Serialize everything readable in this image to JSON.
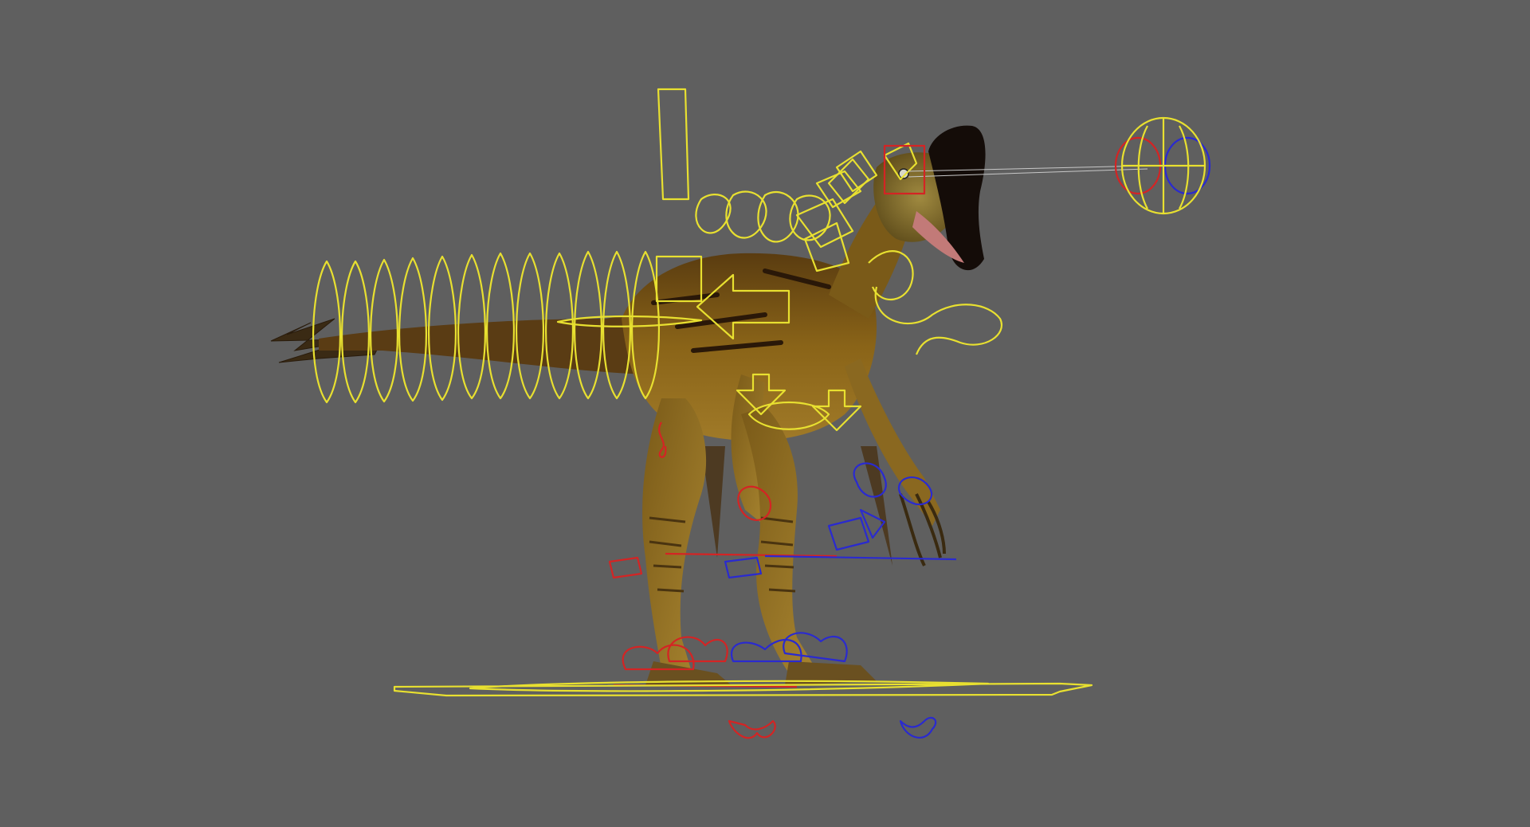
{
  "viewport": {
    "background": "#5f5f5f"
  },
  "colors": {
    "control_main": "#e8e030",
    "control_left": "#d42424",
    "control_right": "#2a2ad0",
    "skin_dark": "#4a3410",
    "skin_mid": "#8a6418",
    "skin_light": "#b08a30",
    "crest": "#140c08",
    "mouth": "#c27a78"
  },
  "icons": {
    "model": "dinosaur-model-icon",
    "eye_target": "eye-aim-control-icon"
  }
}
